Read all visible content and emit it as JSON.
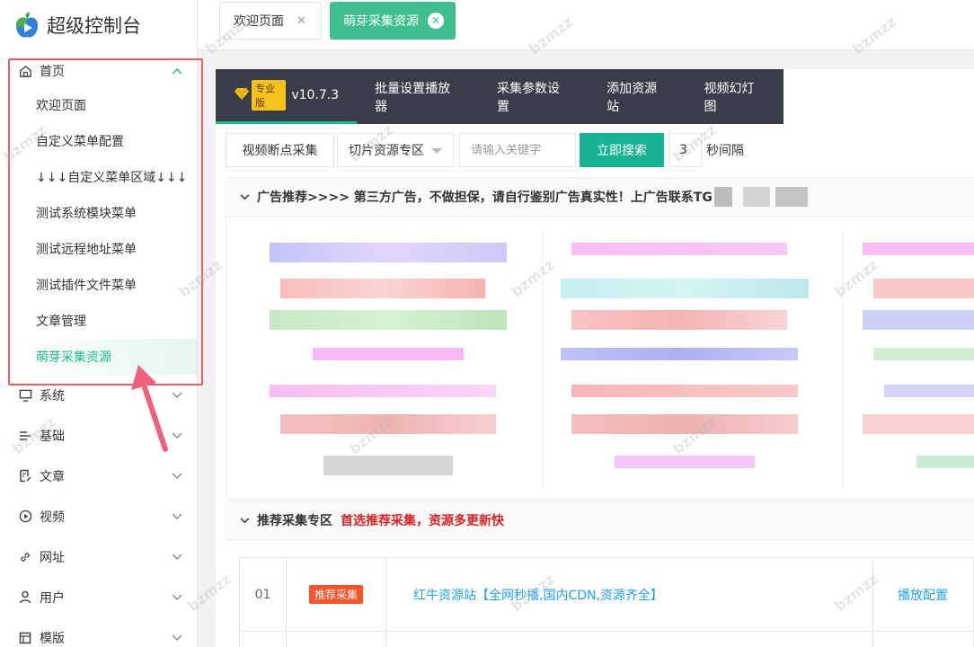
{
  "app": {
    "title": "超级控制台"
  },
  "sidebar": {
    "home": {
      "label": "首页"
    },
    "home_items": [
      {
        "label": "欢迎页面"
      },
      {
        "label": "自定义菜单配置"
      },
      {
        "label": "↓↓↓自定义菜单区域↓↓↓"
      },
      {
        "label": "测试系统模块菜单"
      },
      {
        "label": "测试远程地址菜单"
      },
      {
        "label": "测试插件文件菜单"
      },
      {
        "label": "文章管理"
      },
      {
        "label": "萌芽采集资源"
      }
    ],
    "groups": [
      {
        "label": "系统"
      },
      {
        "label": "基础"
      },
      {
        "label": "文章"
      },
      {
        "label": "视频"
      },
      {
        "label": "网址"
      },
      {
        "label": "用户"
      },
      {
        "label": "模版"
      }
    ]
  },
  "tabs": [
    {
      "label": "欢迎页面"
    },
    {
      "label": "萌芽采集资源"
    }
  ],
  "topnav": {
    "badge": "专业版",
    "version": "v10.7.3",
    "items": [
      {
        "label": "批量设置播放器"
      },
      {
        "label": "采集参数设置"
      },
      {
        "label": "添加资源站"
      },
      {
        "label": "视频幻灯图"
      }
    ]
  },
  "search": {
    "breakpoint_button": "视频断点采集",
    "select_value": "切片资源专区",
    "keyword_placeholder": "请输入关键字",
    "search_button": "立即搜索",
    "interval_value": "3",
    "interval_label": "秒间隔"
  },
  "ad": {
    "heading": "广告推荐>>>>  第三方广告，不做担保，请自行鉴别广告真实性！上广告联系TG"
  },
  "recommend": {
    "heading": "推荐采集专区",
    "subheading": "首选推荐采集，资源多更新快",
    "rows": [
      {
        "no": "01",
        "tag": "推荐采集",
        "name": "红牛资源站【全网秒播,国内CDN,资源齐全】",
        "action": "播放配置"
      }
    ]
  },
  "watermark": "bzmzz",
  "colors": {
    "accent": "#19be8c",
    "navbar": "#393d49",
    "highlight": "#f15a6c",
    "link": "#1e9fff"
  }
}
